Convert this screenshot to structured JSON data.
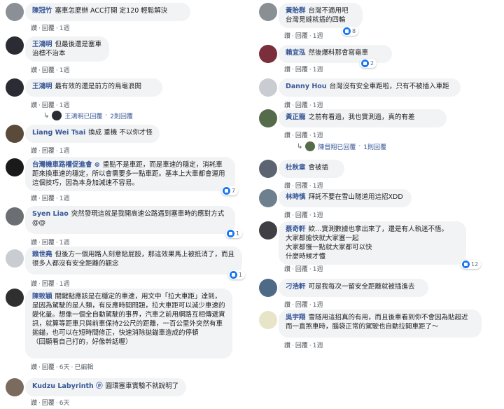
{
  "action_labels": {
    "like": "讚",
    "reply": "回覆",
    "edited": "已編輯"
  },
  "left": [
    {
      "name": "陳冠竹",
      "text": "塞車怎麼辦 ACC打開 定120 輕鬆解決",
      "time": "1週",
      "avatar_color": "#8b8f96"
    },
    {
      "name": "王鴻明",
      "text": "但最後還是塞車\n治標不治本",
      "time": "1週",
      "avatar_color": "#2b2b33"
    },
    {
      "name": "王鴻明",
      "text": "最有效的還是前方的烏龜浪開",
      "time": "1週",
      "avatar_color": "#2b2b33",
      "replies": {
        "who": "王鴻明已回覆",
        "count": "2則回覆"
      }
    },
    {
      "name": "Liang Wei Tsai",
      "text": "換成 重機 不以你才怪",
      "time": "1週",
      "avatar_color": "#5a4a3a"
    },
    {
      "name": "台灣機車路權促進會 ⊚",
      "text": "重點不是車距，而是車速的穩定，消耗車距來換車速的穩定，所以會需要多一點車距。基本上大車都會運用這個技巧，因為本身加減速不容易。",
      "time": "1週",
      "avatar_color": "#1a1a1a",
      "reactions": "7"
    },
    {
      "name": "Syen Liao",
      "text": "突然發現這就是我開高速公路遇到塞車時的應對方式 @@",
      "time": "1週",
      "avatar_color": "#6b6e72",
      "reactions": "1"
    },
    {
      "name": "賴世堯",
      "text": "但後方一個用路人刻意貼屁股，那這效果馬上被抵消了，而且很多人都沒有安全距離的觀念",
      "time": "1週",
      "avatar_color": "#c9ccd1",
      "reactions": "1"
    },
    {
      "name": "陳致穎",
      "text": "關鍵點應該是在穩定的車速，用文中「拉大車距」達到，是因為駕駛的是人類，有反應時間問題，拉大車距可以減少車速的變化量。想像一個全自動駕駛的事界，汽車之前用網路互相傳遞資訊，就算等距車只與前車保持2公尺的距離，一百公里外突然有車拋錨，也可以在短時間修正，快速消除拋錨車造成的停頓\n（回顯看自己打的，好像幹話喔）",
      "time": "6天",
      "avatar_color": "#2f2f2f",
      "edited": true
    },
    {
      "name": "Kudzu Labyrinth ⓟ",
      "text": "圓環塞車實驗不就說明了",
      "time": "6天",
      "avatar_color": "#7b6a5e"
    }
  ],
  "right": [
    {
      "name": "黃貽群",
      "text": "台灣不適用吧\n台灣見縫就插的四輪",
      "time": "1週",
      "avatar_color": "#8a8f94",
      "reactions": "8"
    },
    {
      "name": "賴宜泓",
      "text": "然後爆料那會寫龜車",
      "time": "1週",
      "avatar_color": "#7a2f3a",
      "reactions": "2"
    },
    {
      "name": "Danny Hou",
      "text": "台灣沒有安全車距啦，只有不被插入車距",
      "time": "1週",
      "avatar_color": "#c9ccd1"
    },
    {
      "name": "黃正龍",
      "text": "之前有看過，我也實測過，真的有差",
      "time": "1週",
      "avatar_color": "#556b4a",
      "replies": {
        "who": "陳督翔已回覆",
        "count": "1則回覆"
      }
    },
    {
      "name": "杜秋章",
      "text": "會被插",
      "time": "1週",
      "avatar_color": "#5b6470"
    },
    {
      "name": "林時慎",
      "text": "拜託不要在雪山隧道用這招XDD",
      "time": "1週",
      "avatar_color": "#6e7f8e"
    },
    {
      "name": "蔡奇軒",
      "text": "欸…實測數據也拿出來了，還是有人執迷不悟。\n大家都搶快就大家塞一起\n大家都慢一點就大家都可以快\n什麼時候才懂",
      "time": "1週",
      "avatar_color": "#3f3f45",
      "reactions": "12"
    },
    {
      "name": "刁浩軒",
      "text": "可是我每次一留安全距離就被插進去",
      "time": "1週",
      "avatar_color": "#4f6a86"
    },
    {
      "name": "吳宇翔",
      "text": "雪隧用這招真的有用，而且後車看到你不會因為貼超近而一直煞車時，腦袋正常的駕駛也自動拉開車距了～",
      "time": "1週",
      "avatar_color": "#e8e4c8"
    }
  ]
}
